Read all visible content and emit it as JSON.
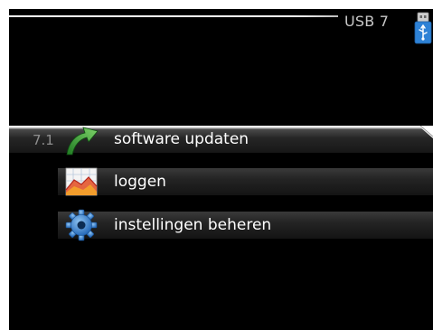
{
  "header": {
    "title": "USB 7",
    "icon": "usb-stick-icon"
  },
  "menu": {
    "items": [
      {
        "number": "7.1",
        "label": "software updaten",
        "icon": "green-arrow-icon",
        "selected": true
      },
      {
        "number": "",
        "label": "loggen",
        "icon": "chart-log-icon",
        "selected": false
      },
      {
        "number": "",
        "label": "instellingen beheren",
        "icon": "gear-icon",
        "selected": false
      }
    ]
  },
  "colors": {
    "background": "#000000",
    "text": "#ffffff",
    "muted_text": "#8f8f8f",
    "accent_green": "#3aa335",
    "accent_blue": "#2a7fd6",
    "accent_red": "#d83a2a"
  }
}
